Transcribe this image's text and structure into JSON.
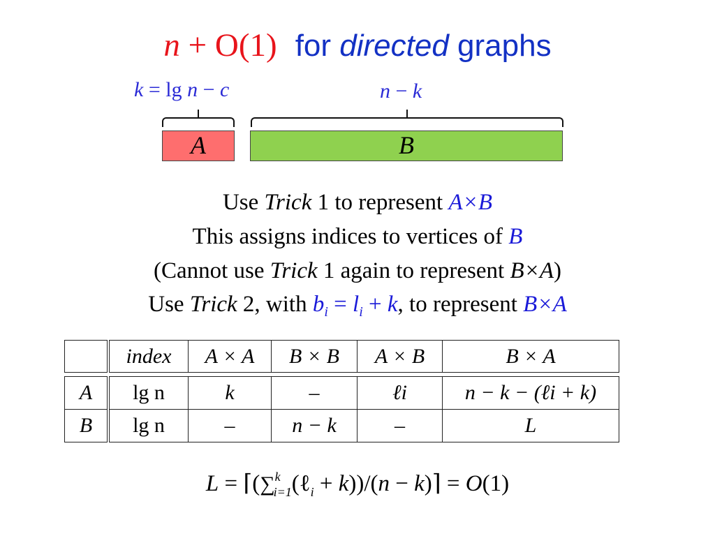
{
  "title": {
    "formula_var": "n",
    "formula_rest": " + O(1)",
    "text_pre": "for ",
    "text_em": "directed",
    "text_post": " graphs",
    "colors": {
      "formula": "#e8141b",
      "text": "#1331c4"
    }
  },
  "diagram": {
    "label_a": {
      "k": "k",
      "eq": " = lg ",
      "n": "n",
      "rest": " − ",
      "c": "c"
    },
    "label_b": {
      "n": "n",
      "minus": " − ",
      "k": "k"
    },
    "bar_a": {
      "label": "A",
      "color": "#fe6e6e"
    },
    "bar_b": {
      "label": "B",
      "color": "#8fd14f"
    }
  },
  "lines": [
    {
      "pre": "Use ",
      "em": "Trick",
      "mid": " 1 to represent ",
      "math": "A×B"
    },
    {
      "pre": "This assigns indices to vertices of ",
      "math": "B"
    },
    {
      "pre": "(Cannot use ",
      "em": "Trick",
      "mid": " 1 again to represent ",
      "math": "B×A",
      "post": ")"
    },
    {
      "pre": "Use ",
      "em": "Trick",
      "mid": " 2, with ",
      "b": "b",
      "sub1": "i",
      "eq": " = ",
      "l": "l",
      "sub2": "i",
      "plus": " + ",
      "k": "k",
      "post": ", to represent ",
      "math": "B×A"
    }
  ],
  "table": {
    "headers": [
      "",
      "index",
      "A × A",
      "B × B",
      "A × B",
      "B × A"
    ],
    "rows": [
      [
        "A",
        "lg n",
        "k",
        "–",
        "ℓi",
        "n − k − (ℓi + k)"
      ],
      [
        "B",
        "lg n",
        "–",
        "n − k",
        "–",
        "L"
      ]
    ]
  },
  "formula": {
    "lhs": "L",
    "eq1": " = ⌈(",
    "sum": "∑",
    "sup": "k",
    "sub": "i=1",
    "body": "(ℓ",
    "sub_i": "i",
    "body2": " + ",
    "k": "k",
    "body3": "))/(",
    "n": "n",
    "minus": " − ",
    "k2": "k",
    "close": ")⌉  =  ",
    "O": "O",
    "rhs": "(1)"
  }
}
